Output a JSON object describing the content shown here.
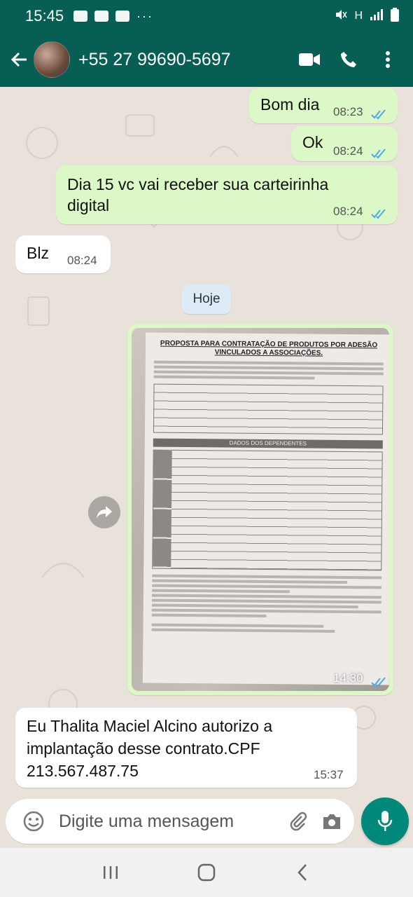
{
  "status_bar": {
    "time": "15:45",
    "dots": "···",
    "network": "H"
  },
  "header": {
    "contact": "+55 27 99690-5697"
  },
  "messages": [
    {
      "text": "Bom dia",
      "time": "08:23"
    },
    {
      "text": "Ok",
      "time": "08:24"
    },
    {
      "text": "Dia 15 vc vai receber sua carteirinha digital",
      "time": "08:24"
    },
    {
      "text": "Blz",
      "time": "08:24"
    },
    {
      "text": "Eu Thalita Maciel Alcino autorizo a implantação desse contrato.CPF 213.567.487.75",
      "time": "15:37"
    }
  ],
  "day_separator": "Hoje",
  "image_message": {
    "time": "14:30",
    "doc_title": "PROPOSTA PARA CONTRATAÇÃO DE PRODUTOS POR ADESÃO VINCULADOS A ASSOCIAÇÕES.",
    "doc_band": "DADOS DOS DEPENDENTES"
  },
  "composer": {
    "placeholder": "Digite uma mensagem"
  },
  "colors": {
    "header": "#075e54",
    "outgoing": "#dcf8c6",
    "incoming": "#ffffff",
    "accent": "#00897b",
    "read_ticks": "#4fa9e6"
  },
  "icons": [
    "back-arrow-icon",
    "video-call-icon",
    "phone-icon",
    "more-options-icon",
    "share-icon",
    "emoji-icon",
    "attach-icon",
    "camera-icon",
    "mic-icon",
    "recents-icon",
    "home-icon",
    "nav-back-icon"
  ]
}
